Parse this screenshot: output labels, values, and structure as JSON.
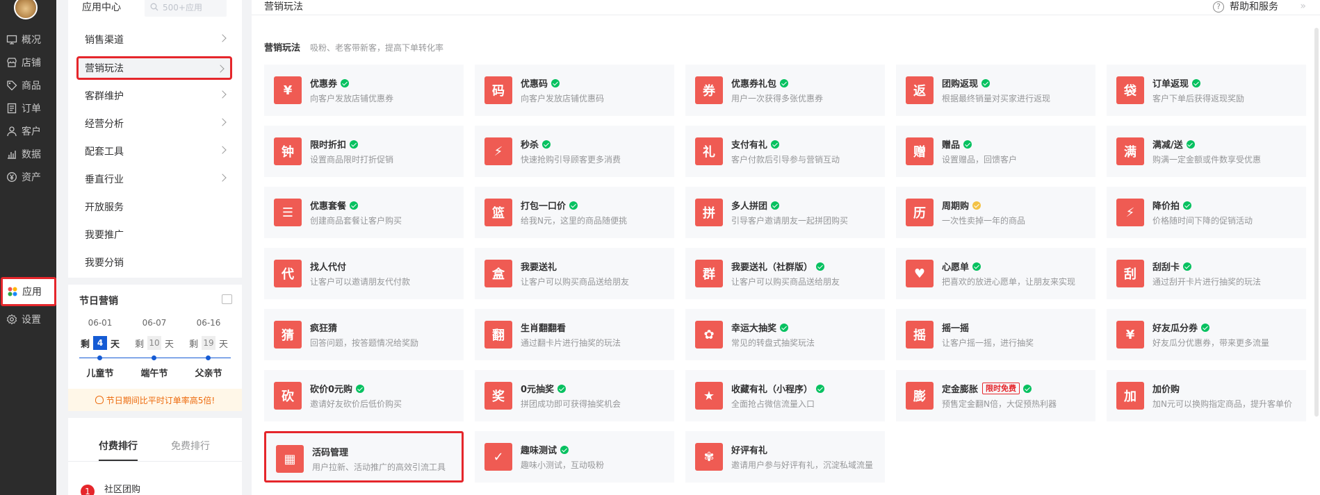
{
  "rail": {
    "items": [
      {
        "label": "概况",
        "icon": "monitor-icon"
      },
      {
        "label": "店铺",
        "icon": "store-icon"
      },
      {
        "label": "商品",
        "icon": "tag-icon"
      },
      {
        "label": "订单",
        "icon": "order-icon"
      },
      {
        "label": "客户",
        "icon": "user-icon"
      },
      {
        "label": "数据",
        "icon": "chart-icon"
      },
      {
        "label": "资产",
        "icon": "yen-icon"
      },
      {
        "label": "应用",
        "icon": "apps-icon"
      },
      {
        "label": "设置",
        "icon": "gear-icon"
      }
    ]
  },
  "subnav": {
    "title": "应用中心",
    "search_placeholder": "500+应用",
    "items": [
      {
        "label": "销售渠道"
      },
      {
        "label": "营销玩法"
      },
      {
        "label": "客群维护"
      },
      {
        "label": "经营分析"
      },
      {
        "label": "配套工具"
      },
      {
        "label": "垂直行业"
      },
      {
        "label": "开放服务"
      },
      {
        "label": "我要推广"
      },
      {
        "label": "我要分销"
      }
    ]
  },
  "festival": {
    "title": "节日营销",
    "events": [
      {
        "date": "06-01",
        "prefix": "剩",
        "days": "4",
        "suffix": "天",
        "name": "儿童节"
      },
      {
        "date": "06-07",
        "prefix": "剩",
        "days": "10",
        "suffix": "天",
        "name": "端午节"
      },
      {
        "date": "06-16",
        "prefix": "剩",
        "days": "19",
        "suffix": "天",
        "name": "父亲节"
      }
    ],
    "tip": "节日期间比平时订单率高5倍!"
  },
  "ranking": {
    "tabs": [
      "付费排行",
      "免费排行"
    ],
    "first": {
      "rank": "1",
      "name": "社区团购"
    }
  },
  "main": {
    "title": "营销玩法",
    "help": "帮助和服务",
    "collapse": "»",
    "section_title": "营销玩法",
    "section_desc": "吸粉、老客带新客，提高下单转化率",
    "cards": [
      {
        "title": "优惠券",
        "desc": "向客户发放店铺优惠券",
        "icon": "¥",
        "badge": ""
      },
      {
        "title": "优惠码",
        "desc": "向客户发放店铺优惠码",
        "icon": "码",
        "badge": ""
      },
      {
        "title": "优惠券礼包",
        "desc": "用户一次获得多张优惠券",
        "icon": "券",
        "badge": ""
      },
      {
        "title": "团购返现",
        "desc": "根据最终销量对买家进行返现",
        "icon": "返",
        "badge": ""
      },
      {
        "title": "订单返现",
        "desc": "客户下单后获得返现奖励",
        "icon": "袋",
        "badge": ""
      },
      {
        "title": "限时折扣",
        "desc": "设置商品限时打折促销",
        "icon": "钟",
        "badge": ""
      },
      {
        "title": "秒杀",
        "desc": "快速抢购引导顾客更多消费",
        "icon": "⚡",
        "badge": ""
      },
      {
        "title": "支付有礼",
        "desc": "客户付款后引导参与营销互动",
        "icon": "礼",
        "badge": ""
      },
      {
        "title": "赠品",
        "desc": "设置赠品，回馈客户",
        "icon": "赠",
        "badge": ""
      },
      {
        "title": "满减/送",
        "desc": "购满一定金额或件数享受优惠",
        "icon": "满",
        "badge": ""
      },
      {
        "title": "优惠套餐",
        "desc": "创建商品套餐让客户购买",
        "icon": "☰",
        "badge": ""
      },
      {
        "title": "打包一口价",
        "desc": "给我N元，这里的商品随便挑",
        "icon": "篮",
        "badge": ""
      },
      {
        "title": "多人拼团",
        "desc": "引导客户邀请朋友一起拼团购买",
        "icon": "拼",
        "badge": ""
      },
      {
        "title": "周期购",
        "desc": "一次性卖掉一年的商品",
        "icon": "历",
        "badge": ""
      },
      {
        "title": "降价拍",
        "desc": "价格随时间下降的促销活动",
        "icon": "⚡",
        "badge": ""
      },
      {
        "title": "找人代付",
        "desc": "让客户可以邀请朋友代付款",
        "icon": "代",
        "badge": ""
      },
      {
        "title": "我要送礼",
        "desc": "让客户可以购买商品送给朋友",
        "icon": "盒",
        "badge": ""
      },
      {
        "title": "我要送礼（社群版）",
        "desc": "让客户可以购买商品送给朋友",
        "icon": "群",
        "badge": ""
      },
      {
        "title": "心愿单",
        "desc": "把喜欢的放进心愿单，让朋友来实现",
        "icon": "♥",
        "badge": ""
      },
      {
        "title": "刮刮卡",
        "desc": "通过刮开卡片进行抽奖的玩法",
        "icon": "刮",
        "badge": ""
      },
      {
        "title": "疯狂猜",
        "desc": "回答问题，按答题情况给奖励",
        "icon": "猜",
        "badge": ""
      },
      {
        "title": "生肖翻翻看",
        "desc": "通过翻卡片进行抽奖的玩法",
        "icon": "翻",
        "badge": ""
      },
      {
        "title": "幸运大抽奖",
        "desc": "常见的转盘式抽奖玩法",
        "icon": "✿",
        "badge": ""
      },
      {
        "title": "摇一摇",
        "desc": "让客户摇一摇，进行抽奖",
        "icon": "摇",
        "badge": ""
      },
      {
        "title": "好友瓜分券",
        "desc": "好友瓜分优惠券，带来更多流量",
        "icon": "¥",
        "badge": ""
      },
      {
        "title": "砍价0元购",
        "desc": "邀请好友砍价后低价购买",
        "icon": "砍",
        "badge": ""
      },
      {
        "title": "0元抽奖",
        "desc": "拼团成功即可获得抽奖机会",
        "icon": "奖",
        "badge": ""
      },
      {
        "title": "收藏有礼（小程序）",
        "desc": "全面抢占微信流量入口",
        "icon": "★",
        "badge": ""
      },
      {
        "title": "定金膨胀",
        "desc": "预售定金翻N倍，大促预热利器",
        "icon": "膨",
        "badge": "限时免费"
      },
      {
        "title": "加价购",
        "desc": "加N元可以换购指定商品，提升客单价",
        "icon": "加",
        "badge": ""
      },
      {
        "title": "活码管理",
        "desc": "用户拉新、活动推广的高效引流工具",
        "icon": "▦",
        "badge": ""
      },
      {
        "title": "趣味测试",
        "desc": "趣味小测试，互动吸粉",
        "icon": "✓",
        "badge": ""
      },
      {
        "title": "好评有礼",
        "desc": "邀请用户参与好评有礼，沉淀私域流量",
        "icon": "✾",
        "badge": ""
      }
    ]
  }
}
